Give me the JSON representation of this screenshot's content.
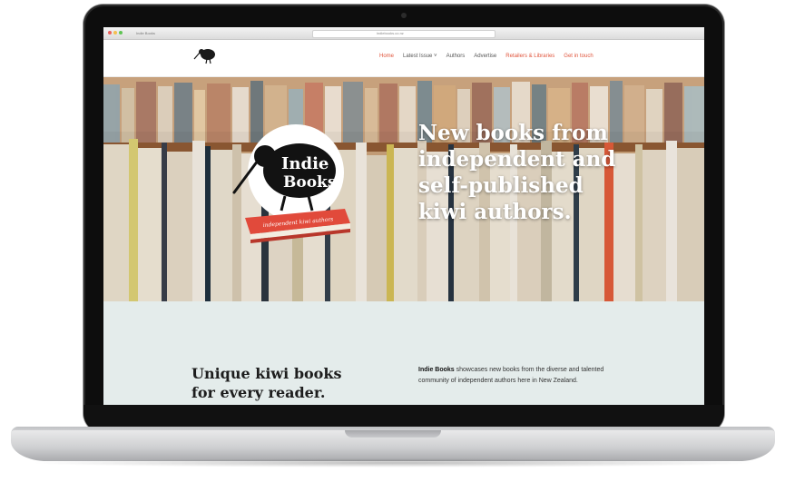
{
  "browser": {
    "tab_title": "Indie Books",
    "url": "indiebooks.co.nz"
  },
  "site": {
    "logo_text": "Indie Books",
    "nav": {
      "items": [
        {
          "label": "Home",
          "state": "active"
        },
        {
          "label": "Latest Issue",
          "has_dropdown": true
        },
        {
          "label": "Authors"
        },
        {
          "label": "Advertise"
        },
        {
          "label": "Retailers & Libraries",
          "style": "accent"
        },
        {
          "label": "Get in touch",
          "style": "accent"
        }
      ],
      "dropdown_caret": "˅"
    },
    "hero": {
      "headline_lines": [
        "New books from",
        "independent and",
        "self-published",
        "kiwi authors."
      ],
      "badge_line1": "Indie",
      "badge_line2": "Books",
      "book_text": "independent kiwi authors"
    },
    "intro": {
      "heading_line1": "Unique kiwi books",
      "heading_line2": "for every reader.",
      "brand": "Indie Books",
      "body": " showcases new books from the diverse and talented community of independent authors here in New Zealand."
    }
  },
  "colors": {
    "accent": "#e0543b",
    "intro_bg": "#e4eceb",
    "badge_book": "#e14a3b"
  }
}
